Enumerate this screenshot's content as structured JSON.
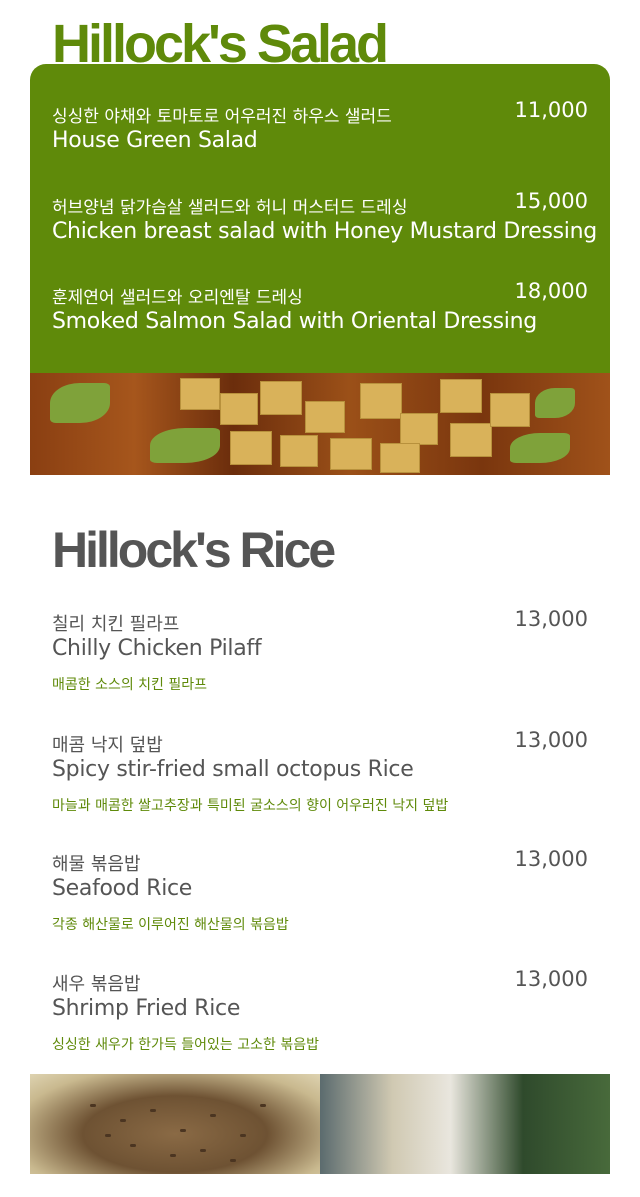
{
  "salad": {
    "title": "Hillock's Salad",
    "items": [
      {
        "ko": "싱싱한 야채와 토마토로 어우러진 하우스 샐러드",
        "en": "House Green Salad",
        "price": "11,000"
      },
      {
        "ko": "허브양념 닭가슴살 샐러드와 허니 머스터드 드레싱",
        "en": "Chicken breast salad with Honey Mustard Dressing",
        "price": "15,000"
      },
      {
        "ko": "훈제연어 샐러드와 오리엔탈 드레싱",
        "en": "Smoked Salmon Salad with Oriental Dressing",
        "price": "18,000"
      }
    ]
  },
  "rice": {
    "title": "Hillock's Rice",
    "items": [
      {
        "ko": "칠리 치킨 필라프",
        "en": "Chilly Chicken Pilaff",
        "price": "13,000",
        "desc": "매콤한 소스의 치킨 필라프"
      },
      {
        "ko": "매콤 낙지 덮밥",
        "en": "Spicy stir-fried small octopus Rice",
        "price": "13,000",
        "desc": "마늘과 매콤한 쌀고추장과 특미된 굴소스의 향이 어우러진 낙지 덮밥"
      },
      {
        "ko": "해물 볶음밥",
        "en": "Seafood Rice",
        "price": "13,000",
        "desc": "각종 해산물로 이루어진 해산물의 볶음밥"
      },
      {
        "ko": "새우 볶음밥",
        "en": "Shrimp Fried Rice",
        "price": "13,000",
        "desc": "싱싱한 새우가 한가득 들어있는 고소한 볶음밥"
      }
    ]
  },
  "colors": {
    "brand_green": "#5f8a0a",
    "text_gray": "#555555"
  }
}
